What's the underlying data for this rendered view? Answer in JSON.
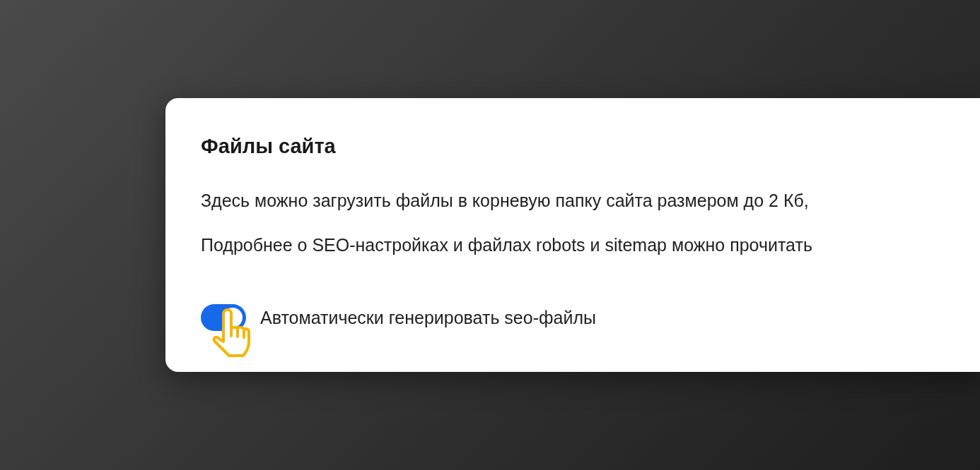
{
  "card": {
    "title": "Файлы сайта",
    "paragraphs": [
      "Здесь можно загрузить файлы в корневую папку сайта размером до 2 Кб,",
      "Подробнее о SEO-настройках и файлах robots и sitemap можно прочитать"
    ],
    "toggle": {
      "label": "Автоматически генерировать seo-файлы",
      "on": true
    }
  }
}
